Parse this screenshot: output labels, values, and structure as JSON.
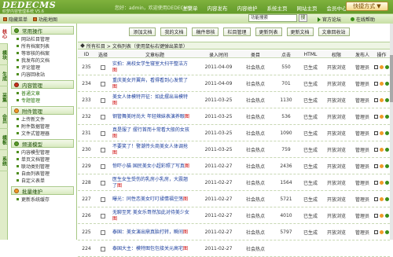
{
  "header": {
    "logo_main": "DEDECMS",
    "logo_sub": "织梦内容管理系统 V5.6",
    "welcome": "您好：admin，欢迎使用DEDECMS!",
    "nav": [
      "主菜单",
      "内容发布",
      "内容维护",
      "系统主页",
      "网站主页",
      "会员中心",
      "注销"
    ],
    "quick_btn": "快捷方式",
    "sub_links": [
      "隐藏菜单",
      "功能地图"
    ],
    "search_value": "功能搜索",
    "search_go": "搜",
    "right_links": [
      "官方论坛",
      "在线帮助"
    ]
  },
  "tabs": [
    "核心",
    "模块",
    "生成",
    "采集",
    "会员",
    "模板",
    "系统"
  ],
  "sidebar": {
    "sections": [
      {
        "title": "常用操作",
        "icon": "green",
        "items": [
          "网站栏目管理",
          "所有档案列表",
          "等审核的档案",
          "我发布的文档",
          "评论管理",
          "内容回收站"
        ]
      },
      {
        "title": "内容管理",
        "icon": "red",
        "items": [
          "普通文章",
          "专题管理"
        ]
      },
      {
        "title": "附件管理",
        "icon": "orange",
        "items": [
          "上传新文件",
          "附件数据管理",
          "文件式管理器"
        ]
      },
      {
        "title": "频道模型",
        "icon": "green",
        "items": [
          "内容模型管理",
          "单页文档管理",
          "联动类别管理",
          "自由列表管理",
          "自定义表单"
        ]
      },
      {
        "title": "批量维护",
        "icon": "orange",
        "items": [
          "更新系统缓存"
        ]
      }
    ]
  },
  "toolbar": [
    "添加文档",
    "我的文档",
    "稿件审核",
    "栏目管理",
    "更新列表",
    "更新文档",
    "文章回收站"
  ],
  "list_title": "所有栏目 > 文档列表（使用鼠标右键弹出菜单）",
  "columns": [
    "ID",
    "选择",
    "文章标题",
    "录入时间",
    "类目",
    "点击",
    "HTML",
    "权限",
    "发布人",
    "操作"
  ],
  "rows": [
    {
      "id": "235",
      "title": "实拍：高校女学生寝室大扫干整洁方",
      "flag": "图",
      "date": "2011-04-09",
      "cat": "社会热点",
      "clicks": "550",
      "html": "已生成",
      "perm": "开放浏览",
      "author": "管理员"
    },
    {
      "id": "234",
      "title": "重庆美女开翼奔，看得看到心发慌了",
      "flag": "图",
      "date": "2011-04-09",
      "cat": "社会热点",
      "clicks": "701",
      "html": "已生成",
      "perm": "开放浏览",
      "author": "管理员"
    },
    {
      "id": "233",
      "title": "美女人体模特开征：如此摆出当模特",
      "flag": "图",
      "date": "2011-03-25",
      "cat": "社会热点",
      "clicks": "1130",
      "html": "已生成",
      "perm": "开放浏览",
      "author": "管理员"
    },
    {
      "id": "232",
      "title": "钢管舞美时尚大 年轻辣妹表演养眼",
      "flag": "图",
      "date": "2011-03-25",
      "cat": "社会热点",
      "clicks": "536",
      "html": "已生成",
      "perm": "开放浏览",
      "author": "管理员"
    },
    {
      "id": "231",
      "title": "真是服了 摆行首而十常看大般的女孩",
      "flag": "图",
      "date": "2011-03-25",
      "cat": "社会热点",
      "clicks": "1090",
      "html": "已生成",
      "perm": "开放浏览",
      "author": "管理员"
    },
    {
      "id": "230",
      "title": "不要笑了！警潮传头商美女人体调抢",
      "flag": "图",
      "date": "2011-03-25",
      "cat": "社会热点",
      "clicks": "759",
      "html": "已生成",
      "perm": "开放浏览",
      "author": "管理员"
    },
    {
      "id": "229",
      "title": "惊吓小猫 国民美女小超彩照了写真",
      "flag": "图",
      "date": "2011-02-27",
      "cat": "社会热点",
      "clicks": "2436",
      "html": "已生成",
      "perm": "开放浏览",
      "author": "管理员"
    },
    {
      "id": "228",
      "title": "医生女生受伤的乳房小乳房，大震翘了",
      "flag": "图",
      "date": "2011-02-27",
      "cat": "社会热点",
      "clicks": "1564",
      "html": "已生成",
      "perm": "开放浏览",
      "author": "管理员"
    },
    {
      "id": "227",
      "title": "曝光：同性恋美女叮叮揉情福空荡",
      "flag": "图",
      "date": "2011-02-27",
      "cat": "社会热点",
      "clicks": "5721",
      "html": "已生成",
      "perm": "开放浏览",
      "author": "管理员"
    },
    {
      "id": "226",
      "title": "无聊至死 美女乐哥然加此对待美少女",
      "flag": "图",
      "date": "2011-02-27",
      "cat": "社会热点",
      "clicks": "4010",
      "html": "已生成",
      "perm": "开放浏览",
      "author": "管理员"
    },
    {
      "id": "225",
      "title": "泰国：美女演出鼎真胎打转，瞬间",
      "flag": "图",
      "date": "2011-02-27",
      "cat": "社会热点",
      "clicks": "5797",
      "html": "已生成",
      "perm": "开放浏览",
      "author": "管理员"
    },
    {
      "id": "224",
      "title": "泰国大主：模特图包包接关元高宅",
      "flag": "图",
      "date": "2011-02-27",
      "cat": "社会热点",
      "clicks": "",
      "html": "",
      "perm": "",
      "author": ""
    }
  ]
}
